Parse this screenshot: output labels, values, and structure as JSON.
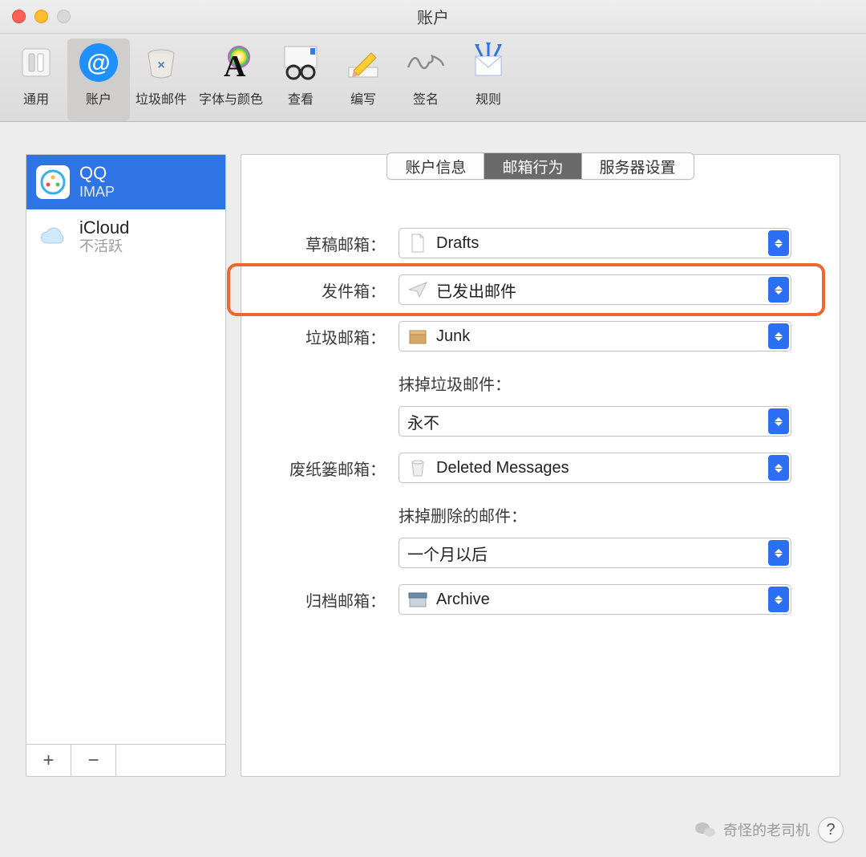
{
  "window": {
    "title": "账户"
  },
  "toolbar": {
    "items": [
      {
        "label": "通用"
      },
      {
        "label": "账户"
      },
      {
        "label": "垃圾邮件"
      },
      {
        "label": "字体与颜色"
      },
      {
        "label": "查看"
      },
      {
        "label": "编写"
      },
      {
        "label": "签名"
      },
      {
        "label": "规则"
      }
    ],
    "selected_index": 1
  },
  "sidebar": {
    "accounts": [
      {
        "name": "QQ",
        "subtitle": "IMAP",
        "selected": true
      },
      {
        "name": "iCloud",
        "subtitle": "不活跃",
        "selected": false
      }
    ],
    "buttons": {
      "add": "+",
      "remove": "−"
    }
  },
  "tabs": {
    "items": [
      "账户信息",
      "邮箱行为",
      "服务器设置"
    ],
    "active_index": 1
  },
  "form": {
    "drafts": {
      "label": "草稿邮箱：",
      "value": "Drafts"
    },
    "sent": {
      "label": "发件箱：",
      "value": "已发出邮件"
    },
    "junk": {
      "label": "垃圾邮箱：",
      "value": "Junk"
    },
    "junk_purge_label": "抹掉垃圾邮件：",
    "junk_purge": {
      "value": "永不"
    },
    "trash": {
      "label": "废纸篓邮箱：",
      "value": "Deleted Messages"
    },
    "trash_purge_label": "抹掉删除的邮件：",
    "trash_purge": {
      "value": "一个月以后"
    },
    "archive": {
      "label": "归档邮箱：",
      "value": "Archive"
    }
  },
  "watermark": {
    "text": "奇怪的老司机"
  },
  "help": {
    "label": "?"
  }
}
